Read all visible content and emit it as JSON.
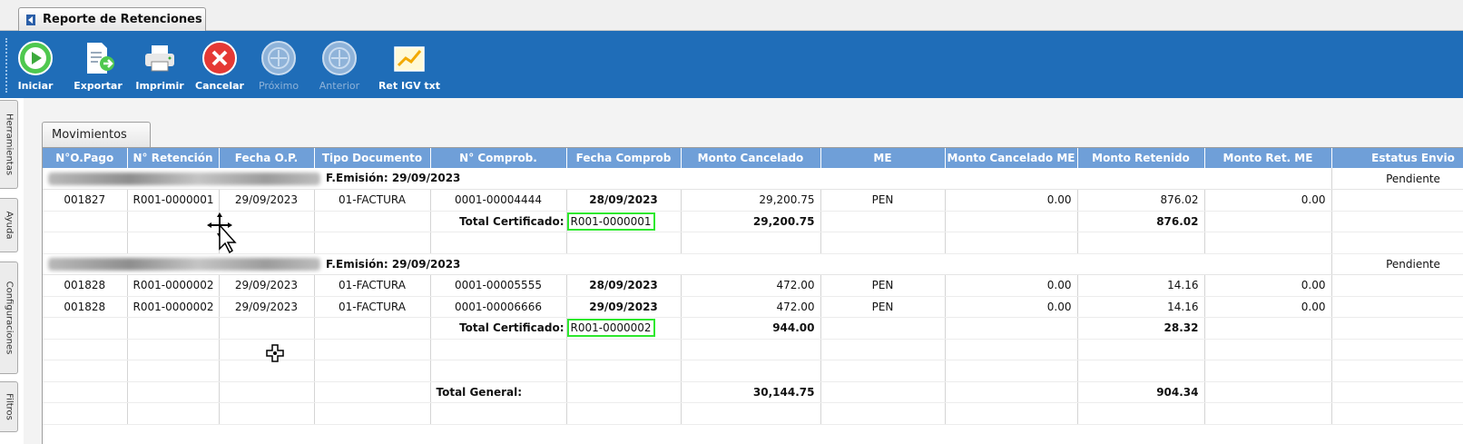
{
  "window": {
    "tab_title": "Reporte de Retenciones"
  },
  "toolbar": {
    "buttons": [
      {
        "label": "Iniciar",
        "icon": "play-icon",
        "enabled": true
      },
      {
        "label": "Exportar",
        "icon": "export-icon",
        "enabled": true
      },
      {
        "label": "Imprimir",
        "icon": "printer-icon",
        "enabled": true
      },
      {
        "label": "Cancelar",
        "icon": "cancel-icon",
        "enabled": true
      },
      {
        "label": "Próximo",
        "icon": "next-icon",
        "enabled": false
      },
      {
        "label": "Anterior",
        "icon": "previous-icon",
        "enabled": false
      },
      {
        "label": "Ret IGV txt",
        "icon": "chart-icon",
        "enabled": true
      }
    ]
  },
  "side_tabs": [
    "Herramientas",
    "Ayuda",
    "Configuraciones",
    "Filtros"
  ],
  "content_tab": "Movimientos",
  "grid": {
    "columns": [
      "N°O.Pago",
      "N° Retención",
      "Fecha O.P.",
      "Tipo Documento",
      "N° Comprob.",
      "Fecha Comprob",
      "Monto Cancelado",
      "ME",
      "Monto Cancelado ME",
      "Monto Retenido",
      "Monto Ret. ME",
      "Estatus Envio"
    ],
    "groups": [
      {
        "emision": "F.Emisión: 29/09/2023",
        "status": "Pendiente",
        "rows": [
          [
            "001827",
            "R001-0000001",
            "29/09/2023",
            "01-FACTURA",
            "0001-00004444",
            "28/09/2023",
            "29,200.75",
            "PEN",
            "0.00",
            "876.02",
            "0.00",
            ""
          ]
        ],
        "total_label": "Total Certificado:",
        "total_cert": "R001-0000001",
        "total_cancelado": "29,200.75",
        "total_retenido": "876.02"
      },
      {
        "emision": "F.Emisión: 29/09/2023",
        "status": "Pendiente",
        "rows": [
          [
            "001828",
            "R001-0000002",
            "29/09/2023",
            "01-FACTURA",
            "0001-00005555",
            "28/09/2023",
            "472.00",
            "PEN",
            "0.00",
            "14.16",
            "0.00",
            ""
          ],
          [
            "001828",
            "R001-0000002",
            "29/09/2023",
            "01-FACTURA",
            "0001-00006666",
            "29/09/2023",
            "472.00",
            "PEN",
            "0.00",
            "14.16",
            "0.00",
            ""
          ]
        ],
        "total_label": "Total Certificado:",
        "total_cert": "R001-0000002",
        "total_cancelado": "944.00",
        "total_retenido": "28.32"
      }
    ],
    "general": {
      "label": "Total General:",
      "cancelado": "30,144.75",
      "retenido": "904.34"
    }
  },
  "colors": {
    "toolbar": "#1f6db8",
    "header": "#6f9fd8",
    "highlight": "#2ee82e"
  }
}
